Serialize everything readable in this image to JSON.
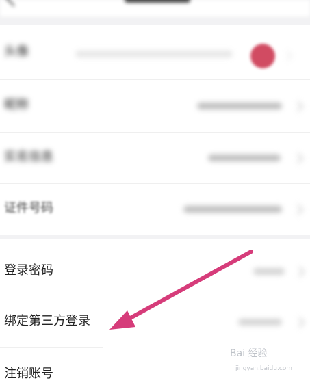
{
  "header": {
    "back_icon": "back-chevron-icon",
    "title": ""
  },
  "profile_items": [
    {
      "label": "头像",
      "value": "",
      "blurred": true
    },
    {
      "label": "昵称",
      "value": "",
      "blurred": true
    },
    {
      "label": "实名信息",
      "value": "",
      "blurred": true
    },
    {
      "label": "证件号码",
      "value": "",
      "blurred": true
    }
  ],
  "account_items": [
    {
      "label": "登录密码",
      "value": ""
    },
    {
      "label": "绑定第三方登录",
      "value": ""
    },
    {
      "label": "注销账号",
      "value": ""
    }
  ],
  "annotation": {
    "arrow_color": "#d63c7a",
    "points_to": "绑定第三方登录"
  },
  "watermark": {
    "text": "Bai 经验",
    "url_text": "jingyan.baidu.com"
  },
  "colors": {
    "background": "#f2f2f4",
    "card": "#ffffff",
    "avatar": "#d14b62"
  }
}
